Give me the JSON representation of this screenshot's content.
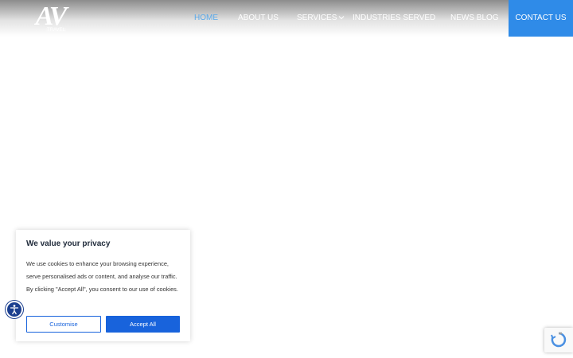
{
  "header": {
    "logo": {
      "letters": "AV",
      "subtitle": "TRAVEL"
    },
    "nav": [
      {
        "label": "HOME",
        "active": true
      },
      {
        "label": "ABOUT US",
        "active": false
      },
      {
        "label": "SERVICES",
        "active": false,
        "has_dropdown": true
      },
      {
        "label": "INDUSTRIES SERVED",
        "active": false
      },
      {
        "label": "NEWS BLOG",
        "active": false
      }
    ],
    "contact_label": "CONTACT US"
  },
  "cookie_banner": {
    "title": "We value your privacy",
    "body": "We use cookies to enhance your browsing experience, serve personalised ads or content, and analyse our traffic. By clicking \"Accept All\", you consent to our use of cookies.",
    "customise_label": "Customise",
    "accept_label": "Accept All"
  },
  "colors": {
    "accent": "#2f8be8",
    "active_nav": "#5aa9ea",
    "cookie_button": "#1863dc",
    "accessibility": "#1b3f8f"
  },
  "icons": {
    "dropdown": "chevron-down-icon",
    "accessibility": "accessibility-icon",
    "recaptcha": "recaptcha-icon"
  }
}
